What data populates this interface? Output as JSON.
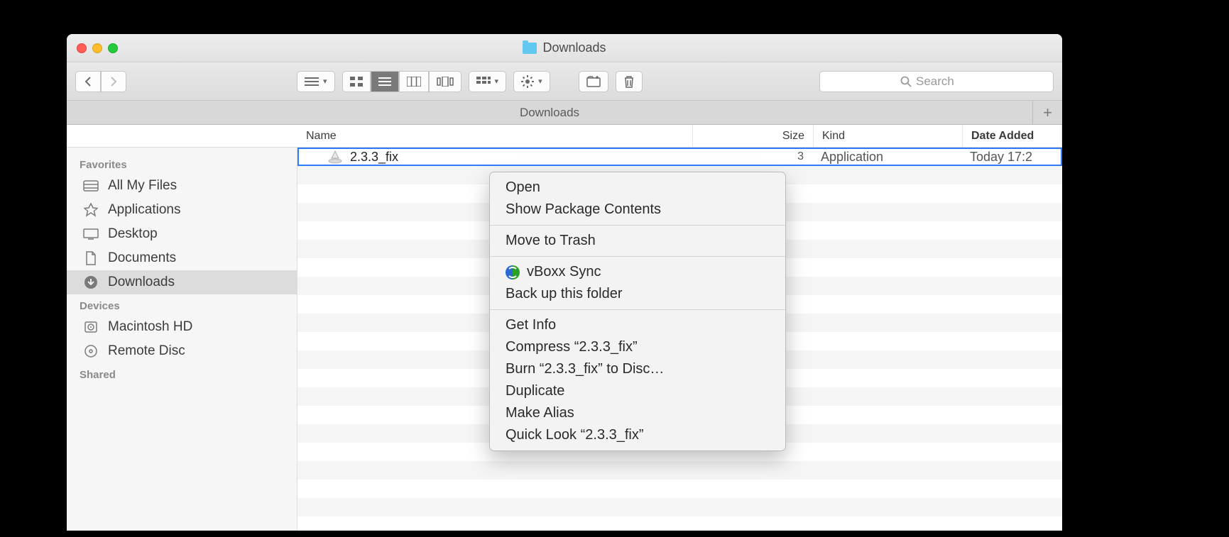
{
  "window": {
    "title": "Downloads"
  },
  "toolbar": {},
  "tabbar": {
    "tab": "Downloads"
  },
  "search": {
    "placeholder": "Search"
  },
  "columns": {
    "name": "Name",
    "size": "Size",
    "kind": "Kind",
    "date": "Date Added"
  },
  "sidebar": {
    "sections": {
      "favorites": "Favorites",
      "devices": "Devices",
      "shared": "Shared"
    },
    "favorites": [
      {
        "label": "All My Files"
      },
      {
        "label": "Applications"
      },
      {
        "label": "Desktop"
      },
      {
        "label": "Documents"
      },
      {
        "label": "Downloads"
      }
    ],
    "devices": [
      {
        "label": "Macintosh HD"
      },
      {
        "label": "Remote Disc"
      }
    ]
  },
  "files": [
    {
      "name": "2.3.3_fix",
      "size_partial": "3",
      "kind": "Application",
      "date": "Today 17:2"
    }
  ],
  "context_menu": {
    "open": "Open",
    "show_pkg": "Show Package Contents",
    "trash": "Move to Trash",
    "vboxx": "vBoxx Sync",
    "backup": "Back up this folder",
    "getinfo": "Get Info",
    "compress": "Compress “2.3.3_fix”",
    "burn": "Burn “2.3.3_fix” to Disc…",
    "duplicate": "Duplicate",
    "alias": "Make Alias",
    "quicklook": "Quick Look “2.3.3_fix”"
  }
}
